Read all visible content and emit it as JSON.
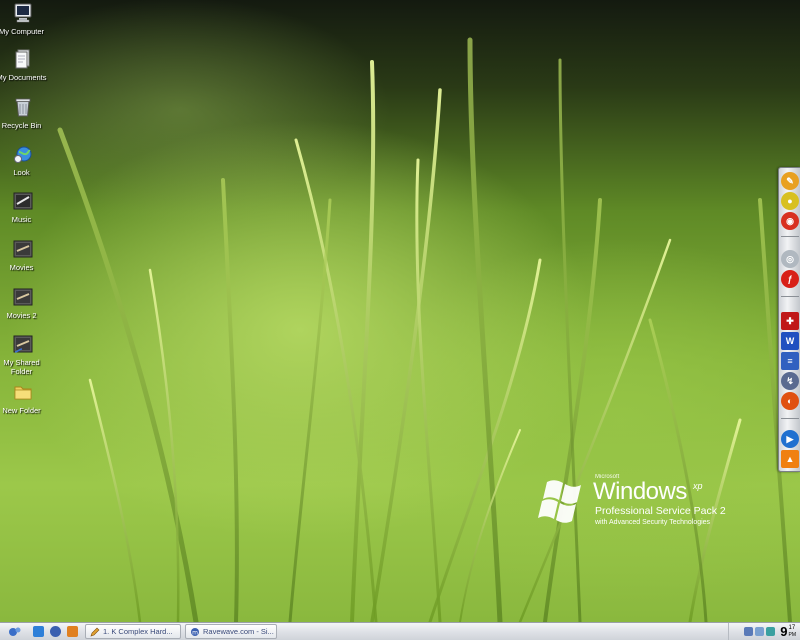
{
  "desktop": {
    "icons": [
      {
        "label": "My Computer",
        "icon": "computer-icon"
      },
      {
        "label": "My Documents",
        "icon": "documents-icon"
      },
      {
        "label": "Recycle Bin",
        "icon": "recycle-bin-icon"
      },
      {
        "label": "Look",
        "icon": "globe-icon"
      },
      {
        "label": "Music",
        "icon": "music-folder-icon"
      },
      {
        "label": "Movies",
        "icon": "movie-folder-icon"
      },
      {
        "label": "Movies 2",
        "icon": "movie-folder-icon"
      },
      {
        "label": "My Shared Folder",
        "icon": "shared-folder-icon"
      },
      {
        "label": "New Folder",
        "icon": "folder-icon"
      }
    ]
  },
  "wallpaper": {
    "brand_small": "Microsoft",
    "brand": "Windows",
    "brand_sup": "xp",
    "edition": "Professional Service Pack 2",
    "tagline": "with Advanced Security Technologies"
  },
  "dock": {
    "items": [
      {
        "icon": "paint-icon",
        "color": "#e8a020"
      },
      {
        "icon": "media-icon",
        "color": "#d8c020"
      },
      {
        "icon": "burn-icon",
        "color": "#d83020"
      },
      {
        "icon": "cd-icon",
        "color": "#b0b8c0"
      },
      {
        "icon": "flash-icon",
        "color": "#d82018"
      },
      {
        "icon": "lifebuoy-icon",
        "color": "#c01818"
      },
      {
        "icon": "word-icon",
        "color": "#2050c0"
      },
      {
        "icon": "flag-icon",
        "color": "#3060c0"
      },
      {
        "icon": "shortcut-icon",
        "color": "#5a6a90"
      },
      {
        "icon": "firefox-icon",
        "color": "#e05010"
      },
      {
        "icon": "play-icon",
        "color": "#2070d0"
      },
      {
        "icon": "vlc-icon",
        "color": "#f08010"
      }
    ]
  },
  "taskbar": {
    "tasks": [
      {
        "label": "1. K Complex Hard...",
        "icon": "pencil-icon"
      },
      {
        "label": "Ravewave.com - Si...",
        "icon": "browser-icon"
      }
    ],
    "clock": {
      "hour": "9",
      "minute": "17",
      "ampm": "PM"
    }
  },
  "colors": {
    "taskbar_text": "#3a4a7a",
    "desktop_text": "#ffffff"
  }
}
